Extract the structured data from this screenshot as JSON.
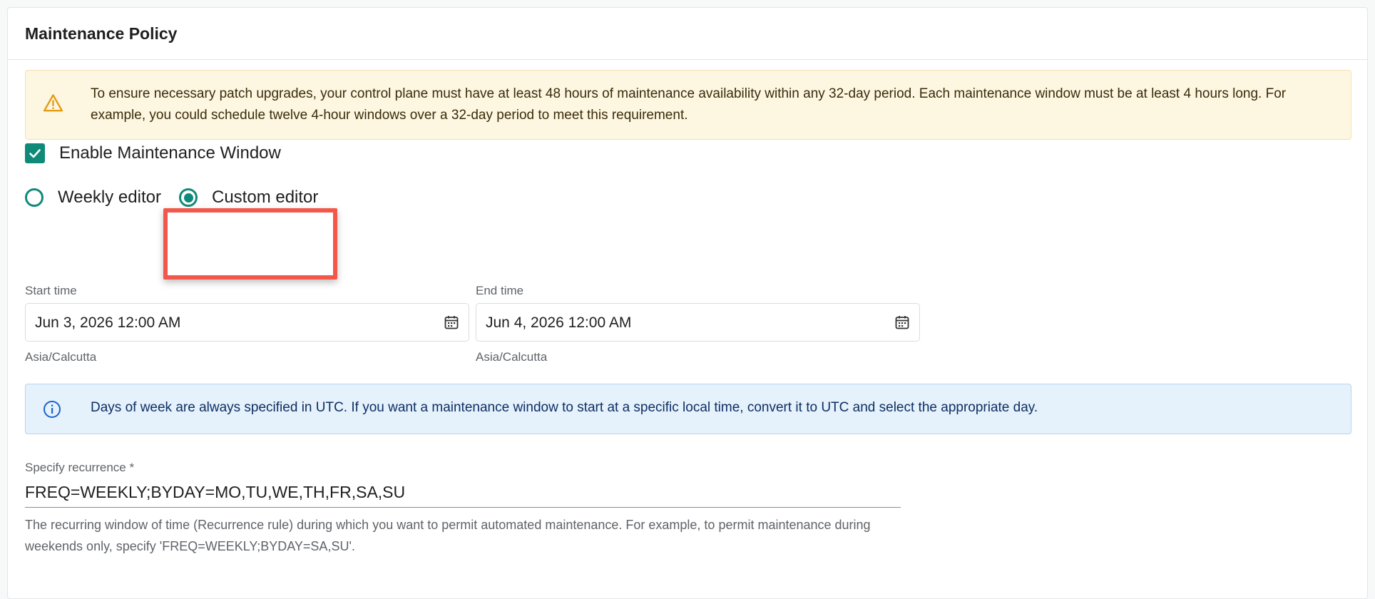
{
  "section": {
    "title": "Maintenance Policy"
  },
  "warning": {
    "icon": "warning-triangle-icon",
    "text": "To ensure necessary patch upgrades, your control plane must have at least 48 hours of maintenance availability within any 32-day period. Each maintenance window must be at least 4 hours long. For example, you could schedule twelve 4-hour windows over a 32-day period to meet this requirement."
  },
  "enable_window": {
    "label": "Enable Maintenance Window",
    "checked": true
  },
  "editor_mode": {
    "options": [
      {
        "label": "Weekly editor",
        "selected": false
      },
      {
        "label": "Custom editor",
        "selected": true
      }
    ]
  },
  "start_time": {
    "label": "Start time",
    "value": "Jun 3, 2026 12:00 AM",
    "timezone": "Asia/Calcutta"
  },
  "end_time": {
    "label": "End time",
    "value": "Jun 4, 2026 12:00 AM",
    "timezone": "Asia/Calcutta"
  },
  "info": {
    "icon": "info-icon",
    "text": "Days of week are always specified in UTC. If you want a maintenance window to start at a specific local time, convert it to UTC and select the appropriate day."
  },
  "recurrence": {
    "label": "Specify recurrence *",
    "value": "FREQ=WEEKLY;BYDAY=MO,TU,WE,TH,FR,SA,SU",
    "help": "The recurring window of time (Recurrence rule) during which you want to permit automated maintenance. For example, to permit maintenance during weekends only, specify 'FREQ=WEEKLY;BYDAY=SA,SU'."
  },
  "colors": {
    "accent": "#0f8a78",
    "highlight": "#f2574a",
    "warning_bg": "#fdf6e1",
    "info_bg": "#e5f1fb"
  }
}
